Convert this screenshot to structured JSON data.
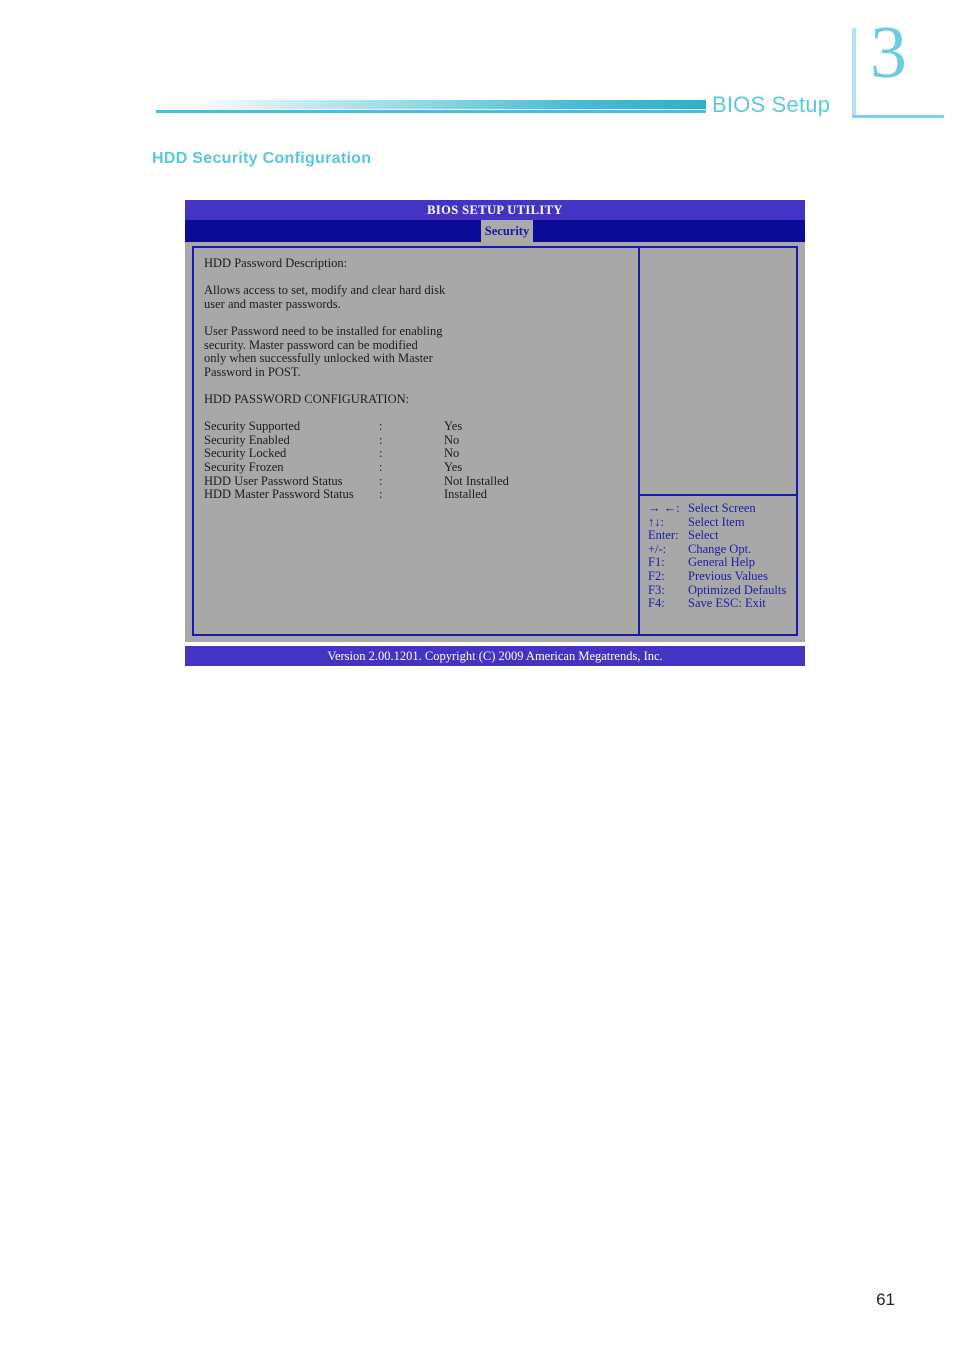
{
  "header": {
    "chapter_number": "3",
    "title": "BIOS Setup"
  },
  "section": {
    "heading": "HDD Security Configuration"
  },
  "bios": {
    "title": "BIOS SETUP UTILITY",
    "tab": "Security",
    "description": [
      "HDD Password Description:",
      "",
      "Allows access to set, modify and clear hard disk",
      "user and master passwords.",
      "",
      "User Password need to be installed for enabling",
      "security. Master password can be modified",
      "only when successfully unlocked with Master",
      "Password in POST.",
      "",
      "HDD PASSWORD CONFIGURATION:"
    ],
    "status_rows": [
      {
        "label": "Security Supported",
        "colon": ":",
        "value": "Yes"
      },
      {
        "label": "Security Enabled",
        "colon": ":",
        "value": "No"
      },
      {
        "label": "Security Locked",
        "colon": ":",
        "value": "No"
      },
      {
        "label": "Security Frozen",
        "colon": ":",
        "value": "Yes"
      },
      {
        "label": "HDD User Password Status",
        "colon": ":",
        "value": "Not Installed"
      },
      {
        "label": "HDD Master Password Status",
        "colon": ":",
        "value": "Installed"
      }
    ],
    "help_keys": [
      {
        "key": "→ ←:",
        "action": "Select Screen"
      },
      {
        "key": "↑↓:",
        "action": "Select Item"
      },
      {
        "key": "Enter:",
        "action": "Select"
      },
      {
        "key": "+/-:",
        "action": "Change Opt."
      },
      {
        "key": "F1:",
        "action": "General Help"
      },
      {
        "key": "F2:",
        "action": "Previous Values"
      },
      {
        "key": "F3:",
        "action": "Optimized Defaults"
      },
      {
        "key": "F4:",
        "action": "Save   ESC: Exit"
      }
    ],
    "footer": "Version 2.00.1201. Copyright (C) 2009 American Megatrends, Inc."
  },
  "page": {
    "number": "61"
  },
  "colors": {
    "accent_teal": "#5cc8dd",
    "bios_titlebar": "#4534c4",
    "bios_tabbar": "#0b0b96",
    "bios_body": "#a8a8a8",
    "bios_border": "#1a1aa8",
    "help_text": "#1d1da6"
  }
}
